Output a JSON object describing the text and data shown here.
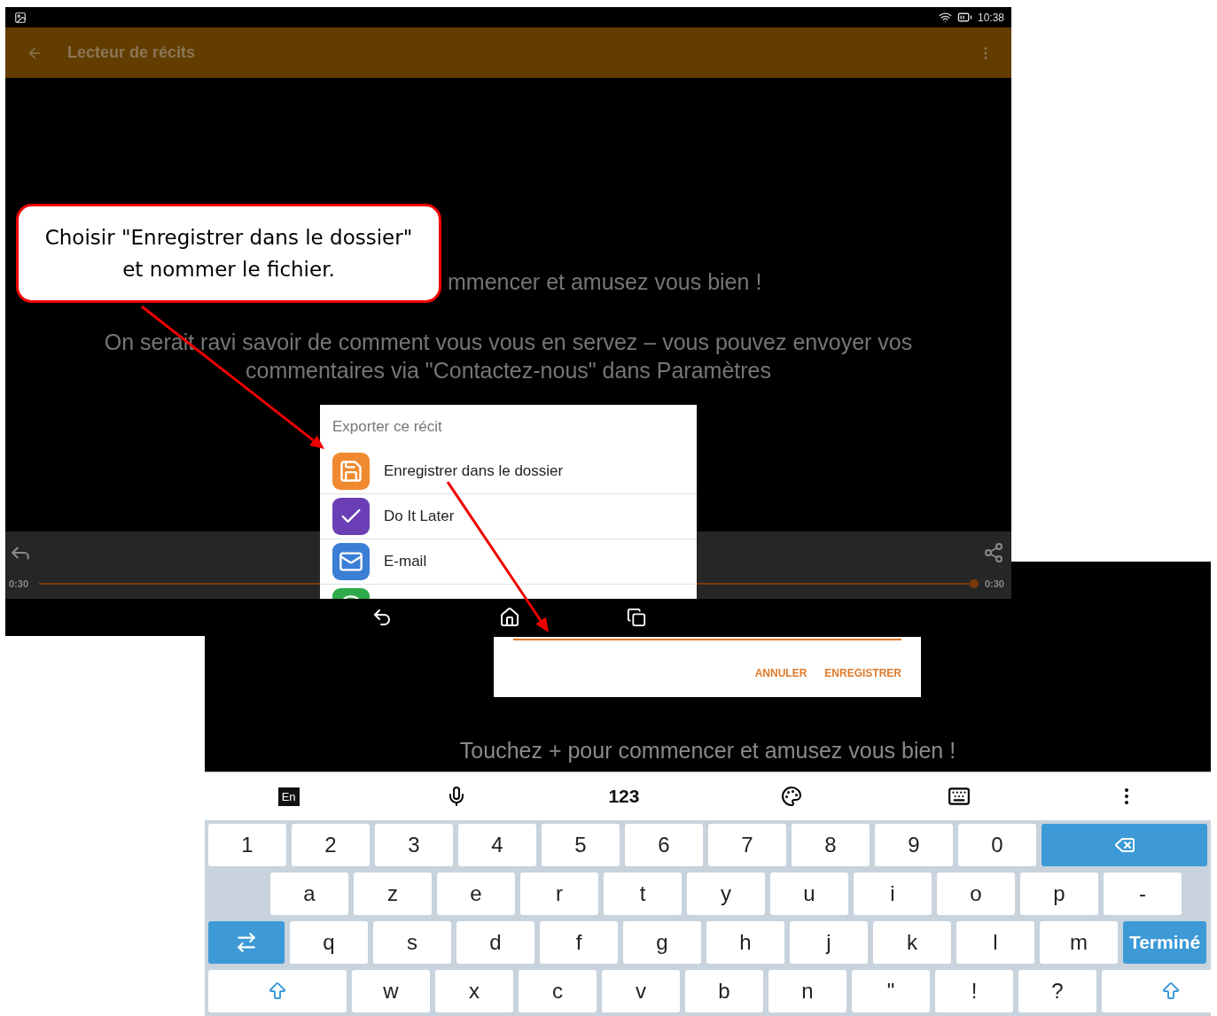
{
  "status_bar": {
    "time": "10:38"
  },
  "app_bar": {
    "title": "Lecteur de récits"
  },
  "background_text": [
    "mmencer et amusez vous bien !",
    "On serait ravi savoir de comment vous vous en servez – vous pouvez envoyer vos commentaires via \"Contactez-nous\" dans Paramètres"
  ],
  "export_dialog": {
    "title": "Exporter ce récit",
    "items": [
      {
        "kind": "save",
        "label": "Enregistrer dans le dossier"
      },
      {
        "kind": "task",
        "label": "Do It Later"
      },
      {
        "kind": "mail",
        "label": "E-mail"
      },
      {
        "kind": "chat"
      }
    ]
  },
  "player": {
    "elapsed": "0:30",
    "total": "0:30",
    "level": 1
  },
  "save_dialog": {
    "buttons": [
      "ANNULER",
      "ENREGISTRER"
    ]
  },
  "message": "Touchez + pour commencer et amusez vous bien !",
  "keyboard": {
    "toolbar": [
      {
        "kind": "lang",
        "label": "En"
      },
      {
        "kind": "mic"
      },
      {
        "kind": "text",
        "label": "123"
      },
      {
        "kind": "palette"
      },
      {
        "kind": "hide"
      },
      {
        "kind": "more"
      }
    ],
    "rows": [
      [
        {
          "label": "1"
        },
        {
          "label": "2"
        },
        {
          "label": "3"
        },
        {
          "label": "4"
        },
        {
          "label": "5"
        },
        {
          "label": "6"
        },
        {
          "label": "7"
        },
        {
          "label": "8"
        },
        {
          "label": "9"
        },
        {
          "label": "0"
        },
        {
          "kind": "backspace"
        }
      ],
      [
        {
          "kind": "gap"
        },
        {
          "label": "a"
        },
        {
          "label": "z"
        },
        {
          "label": "e"
        },
        {
          "label": "r"
        },
        {
          "label": "t"
        },
        {
          "label": "y"
        },
        {
          "label": "u"
        },
        {
          "label": "i"
        },
        {
          "label": "o"
        },
        {
          "label": "p"
        },
        {
          "label": "-"
        }
      ],
      [
        {
          "kind": "switch"
        },
        {
          "label": "q"
        },
        {
          "label": "s"
        },
        {
          "label": "d"
        },
        {
          "label": "f"
        },
        {
          "label": "g"
        },
        {
          "label": "h"
        },
        {
          "label": "j"
        },
        {
          "label": "k"
        },
        {
          "label": "l"
        },
        {
          "label": "m"
        },
        {
          "kind": "done",
          "label": "Terminé"
        }
      ],
      [
        {
          "kind": "shift"
        },
        {
          "label": "w"
        },
        {
          "label": "x"
        },
        {
          "label": "c"
        },
        {
          "label": "v"
        },
        {
          "label": "b"
        },
        {
          "label": "n"
        },
        {
          "label": "\""
        },
        {
          "label": "!"
        },
        {
          "label": "?"
        },
        {
          "kind": "shift"
        }
      ]
    ]
  },
  "callout": {
    "text": "Choisir \"Enregistrer dans le dossier\"\net nommer le fichier."
  }
}
